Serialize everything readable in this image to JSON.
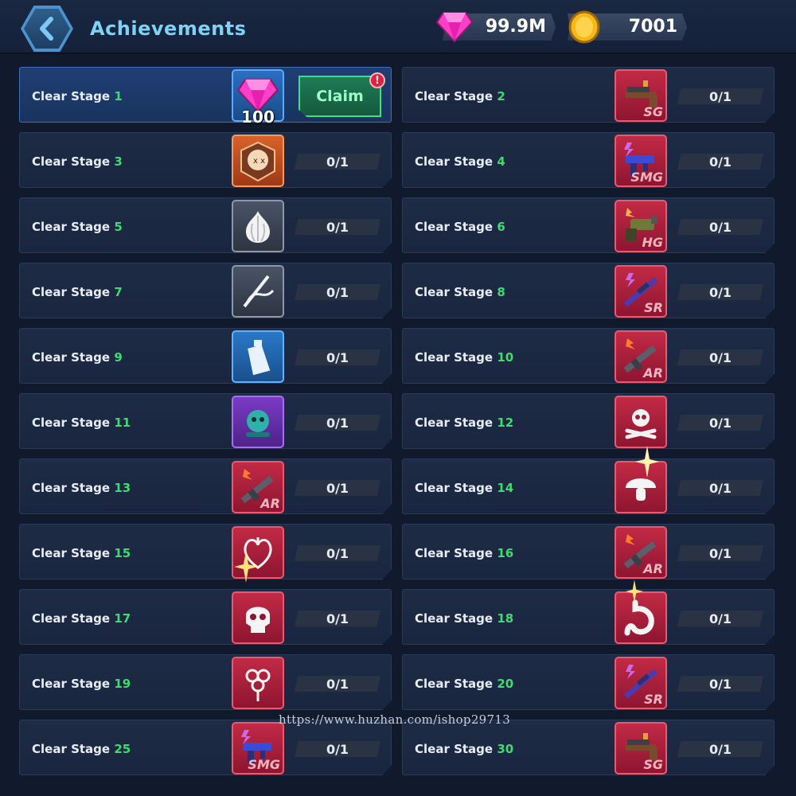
{
  "header": {
    "title": "Achievements",
    "gems": "99.9M",
    "coins": "7001"
  },
  "colors": {
    "accent_title": "#7dd3f6",
    "stage_number": "#3ddc6f",
    "claim_green": "#3ce08a",
    "gem_pink": "#ff3fc8",
    "coin_gold": "#f5b817"
  },
  "first_card": {
    "label": "Clear Stage",
    "number": "1",
    "reward_icon": "gem-icon",
    "reward_amount": "100",
    "claim_label": "Claim",
    "alert": "!"
  },
  "cards": [
    {
      "label": "Clear Stage",
      "number": "2",
      "icon": "shotgun-icon",
      "tag": "SG",
      "tile": "red",
      "progress": "0/1"
    },
    {
      "label": "Clear Stage",
      "number": "3",
      "icon": "skull-badge-icon",
      "tag": "",
      "tile": "orange",
      "progress": "0/1"
    },
    {
      "label": "Clear Stage",
      "number": "4",
      "icon": "smg-icon",
      "tag": "SMG",
      "tile": "red",
      "progress": "0/1"
    },
    {
      "label": "Clear Stage",
      "number": "5",
      "icon": "garlic-icon",
      "tag": "",
      "tile": "grey",
      "progress": "0/1"
    },
    {
      "label": "Clear Stage",
      "number": "6",
      "icon": "heavy-gun-icon",
      "tag": "HG",
      "tile": "red",
      "progress": "0/1"
    },
    {
      "label": "Clear Stage",
      "number": "7",
      "icon": "needle-thread-icon",
      "tag": "",
      "tile": "grey",
      "progress": "0/1"
    },
    {
      "label": "Clear Stage",
      "number": "8",
      "icon": "sniper-rifle-icon",
      "tag": "SR",
      "tile": "red",
      "progress": "0/1"
    },
    {
      "label": "Clear Stage",
      "number": "9",
      "icon": "water-bottle-icon",
      "tag": "",
      "tile": "blue",
      "progress": "0/1"
    },
    {
      "label": "Clear Stage",
      "number": "10",
      "icon": "assault-rifle-icon",
      "tag": "AR",
      "tile": "red",
      "progress": "0/1"
    },
    {
      "label": "Clear Stage",
      "number": "11",
      "icon": "robot-drone-icon",
      "tag": "",
      "tile": "purple",
      "progress": "0/1"
    },
    {
      "label": "Clear Stage",
      "number": "12",
      "icon": "skull-crossbones-icon",
      "tag": "",
      "tile": "red",
      "progress": "0/1"
    },
    {
      "label": "Clear Stage",
      "number": "13",
      "icon": "assault-rifle-icon",
      "tag": "AR",
      "tile": "red",
      "progress": "0/1"
    },
    {
      "label": "Clear Stage",
      "number": "14",
      "icon": "mushroom-icon",
      "tag": "",
      "tile": "red",
      "progress": "0/1"
    },
    {
      "label": "Clear Stage",
      "number": "15",
      "icon": "heart-organ-icon",
      "tag": "",
      "tile": "red",
      "progress": "0/1"
    },
    {
      "label": "Clear Stage",
      "number": "16",
      "icon": "assault-rifle-icon",
      "tag": "AR",
      "tile": "red",
      "progress": "0/1"
    },
    {
      "label": "Clear Stage",
      "number": "17",
      "icon": "skull-icon",
      "tag": "",
      "tile": "red",
      "progress": "0/1"
    },
    {
      "label": "Clear Stage",
      "number": "18",
      "icon": "stomach-icon",
      "tag": "",
      "tile": "red",
      "progress": "0/1"
    },
    {
      "label": "Clear Stage",
      "number": "19",
      "icon": "flower-icon",
      "tag": "",
      "tile": "red",
      "progress": "0/1"
    },
    {
      "label": "Clear Stage",
      "number": "20",
      "icon": "sniper-rifle-icon",
      "tag": "SR",
      "tile": "red",
      "progress": "0/1"
    },
    {
      "label": "Clear Stage",
      "number": "25",
      "icon": "smg-icon",
      "tag": "SMG",
      "tile": "red",
      "progress": "0/1"
    },
    {
      "label": "Clear Stage",
      "number": "30",
      "icon": "shotgun-icon",
      "tag": "SG",
      "tile": "red",
      "progress": "0/1"
    }
  ],
  "watermark": "https://www.huzhan.com/ishop29713"
}
